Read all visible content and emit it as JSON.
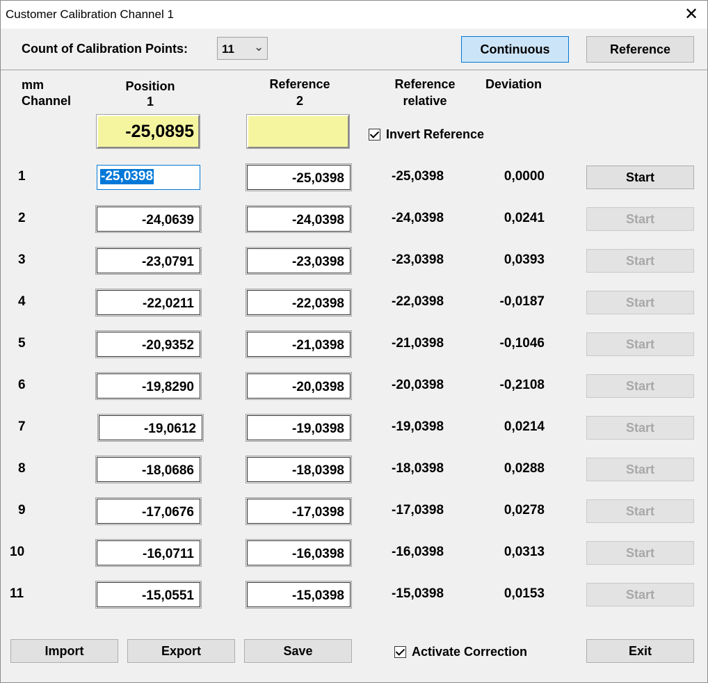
{
  "window": {
    "title": "Customer Calibration Channel 1",
    "close": "✕"
  },
  "top": {
    "count_label": "Count of Calibration Points:",
    "count_value": "11",
    "continuous_button": "Continuous",
    "reference_button": "Reference"
  },
  "headers": {
    "mm": "mm",
    "channel": "Channel",
    "position": "Position",
    "position_num": "1",
    "reference": "Reference",
    "reference_num": "2",
    "ref_relative_1": "Reference",
    "ref_relative_2": "relative",
    "deviation": "Deviation"
  },
  "live": {
    "position": "-25,0895",
    "reference": ""
  },
  "invert_reference_label": "Invert Reference",
  "rows": [
    {
      "n": "1",
      "pos": "-25,0398",
      "ref": "-25,0398",
      "rel": "-25,0398",
      "dev": "0,0000",
      "start": "Start"
    },
    {
      "n": "2",
      "pos": "-24,0639",
      "ref": "-24,0398",
      "rel": "-24,0398",
      "dev": "0,0241",
      "start": "Start"
    },
    {
      "n": "3",
      "pos": "-23,0791",
      "ref": "-23,0398",
      "rel": "-23,0398",
      "dev": "0,0393",
      "start": "Start"
    },
    {
      "n": "4",
      "pos": "-22,0211",
      "ref": "-22,0398",
      "rel": "-22,0398",
      "dev": "-0,0187",
      "start": "Start"
    },
    {
      "n": "5",
      "pos": "-20,9352",
      "ref": "-21,0398",
      "rel": "-21,0398",
      "dev": "-0,1046",
      "start": "Start"
    },
    {
      "n": "6",
      "pos": "-19,8290",
      "ref": "-20,0398",
      "rel": "-20,0398",
      "dev": "-0,2108",
      "start": "Start"
    },
    {
      "n": "7",
      "pos": "-19,0612",
      "ref": "-19,0398",
      "rel": "-19,0398",
      "dev": "0,0214",
      "start": "Start"
    },
    {
      "n": "8",
      "pos": "-18,0686",
      "ref": "-18,0398",
      "rel": "-18,0398",
      "dev": "0,0288",
      "start": "Start"
    },
    {
      "n": "9",
      "pos": "-17,0676",
      "ref": "-17,0398",
      "rel": "-17,0398",
      "dev": "0,0278",
      "start": "Start"
    },
    {
      "n": "10",
      "pos": "-16,0711",
      "ref": "-16,0398",
      "rel": "-16,0398",
      "dev": "0,0313",
      "start": "Start"
    },
    {
      "n": "11",
      "pos": "-15,0551",
      "ref": "-15,0398",
      "rel": "-15,0398",
      "dev": "0,0153",
      "start": "Start"
    }
  ],
  "bottom": {
    "import": "Import",
    "export": "Export",
    "save": "Save",
    "activate_correction": "Activate Correction",
    "exit": "Exit"
  }
}
